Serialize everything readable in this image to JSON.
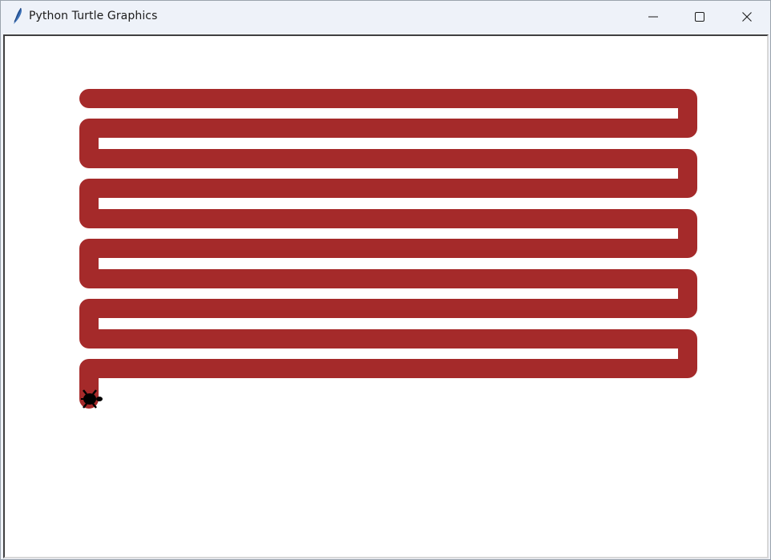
{
  "window": {
    "title": "Python Turtle Graphics",
    "app_icon": "feather-icon",
    "controls": {
      "minimize_icon": "minimize-icon",
      "maximize_icon": "maximize-icon",
      "close_icon": "close-icon"
    }
  },
  "canvas": {
    "background": "#ffffff",
    "pen_color": "#a52a2a",
    "turtle_color": "#000000",
    "turtle_shape": "turtle-icon"
  }
}
